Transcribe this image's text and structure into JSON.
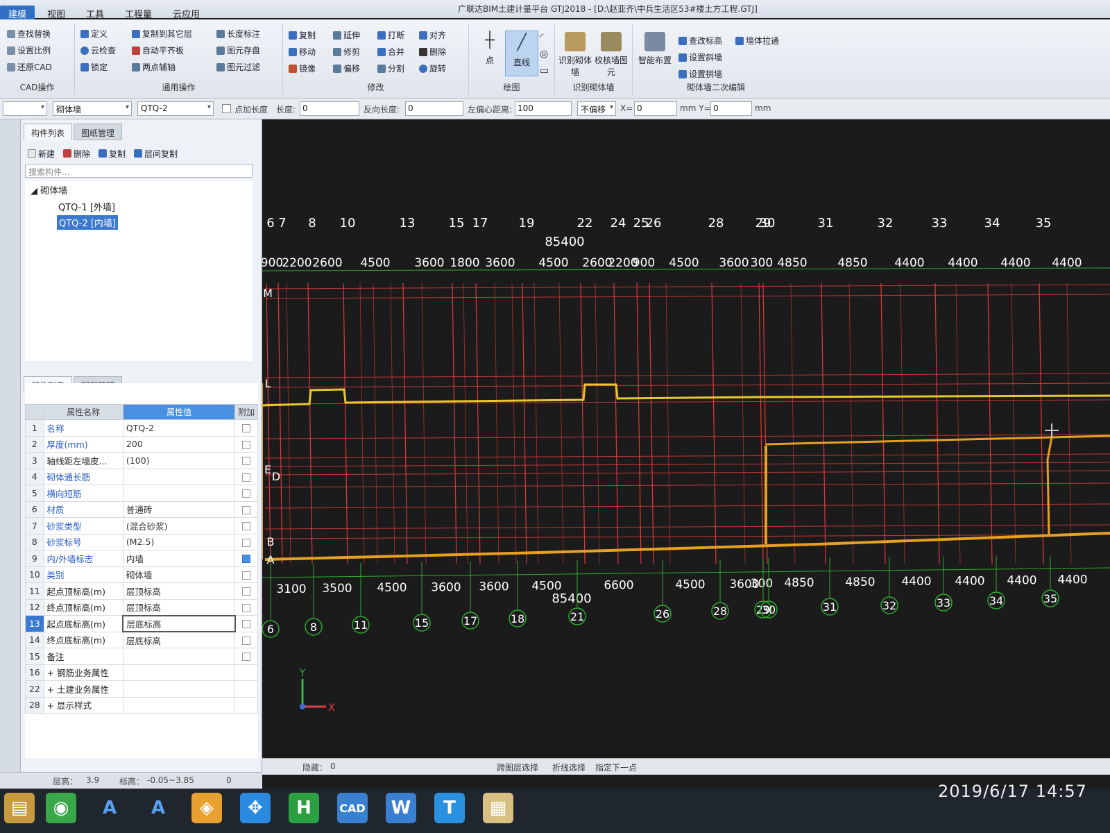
{
  "window": {
    "title": "广联达BIM土建计量平台 GTJ2018 - [D:\\赵亚齐\\中兵生活区53#楼土方工程.GTJ]"
  },
  "menu": [
    "建模",
    "视图",
    "工具",
    "工程量",
    "云应用"
  ],
  "ribbon": {
    "cad": {
      "items": [
        "查找替换",
        "设置比例",
        "还原CAD"
      ],
      "group": "CAD操作"
    },
    "common": {
      "items": [
        "定义",
        "复制到其它层",
        "长度标注",
        "云检查",
        "自动平齐板",
        "图元存盘",
        "锁定",
        "两点辅轴",
        "图元过滤"
      ],
      "group": "通用操作"
    },
    "modify": {
      "items": [
        "复制",
        "延伸",
        "打断",
        "对齐",
        "移动",
        "修剪",
        "合并",
        "删除",
        "镜像",
        "偏移",
        "分割",
        "旋转"
      ],
      "group": "修改"
    },
    "draw": {
      "items": [
        "点",
        "直线"
      ],
      "group": "绘图"
    },
    "identify": {
      "items": [
        "识别砌体墙",
        "校核墙图元"
      ],
      "group": "识别砌体墙"
    },
    "secondary": {
      "items": [
        "智能布置",
        "查改标高",
        "墙体拉通",
        "设置斜墙",
        "设置拱墙"
      ],
      "group": "砌体墙二次编辑"
    }
  },
  "toolbar": {
    "type_select": "砌体墙",
    "component_select": "QTQ-2",
    "add_length_label": "点加长度",
    "length_label": "长度:",
    "length_value": "0",
    "reverse_length_label": "反向长度:",
    "reverse_length_value": "0",
    "offset_label": "左偏心距离:",
    "offset_value": "100",
    "offset_mode": "不偏移",
    "x_label": "X=",
    "x_value": "0",
    "y_label": "mm  Y=",
    "y_value": "0",
    "unit": "mm"
  },
  "component_panel": {
    "tabs": [
      "构件列表",
      "图纸管理"
    ],
    "tools": [
      "新建",
      "删除",
      "复制",
      "层间复制"
    ],
    "search_placeholder": "搜索构件...",
    "tree_root": "砌体墙",
    "items": [
      "QTQ-1 [外墙]",
      "QTQ-2 [内墙]"
    ],
    "selected_index": 1
  },
  "property_panel": {
    "tabs": [
      "属性列表",
      "图层管理"
    ],
    "headers": [
      "属性名称",
      "属性值",
      "附加"
    ],
    "rows": [
      {
        "n": "1",
        "name": "名称",
        "value": "QTQ-2",
        "blue": true,
        "check": false
      },
      {
        "n": "2",
        "name": "厚度(mm)",
        "value": "200",
        "blue": true,
        "check": false
      },
      {
        "n": "3",
        "name": "轴线距左墙皮...",
        "value": "(100)",
        "blue": false,
        "check": false
      },
      {
        "n": "4",
        "name": "砌体通长筋",
        "value": "",
        "blue": true,
        "check": false
      },
      {
        "n": "5",
        "name": "横向短筋",
        "value": "",
        "blue": true,
        "check": false
      },
      {
        "n": "6",
        "name": "材质",
        "value": "普通砖",
        "blue": true,
        "check": false
      },
      {
        "n": "7",
        "name": "砂浆类型",
        "value": "(混合砂浆)",
        "blue": true,
        "check": false
      },
      {
        "n": "8",
        "name": "砂浆标号",
        "value": "(M2.5)",
        "blue": true,
        "check": false
      },
      {
        "n": "9",
        "name": "内/外墙标志",
        "value": "内墙",
        "blue": true,
        "check": true
      },
      {
        "n": "10",
        "name": "类别",
        "value": "砌体墙",
        "blue": true,
        "check": false
      },
      {
        "n": "11",
        "name": "起点顶标高(m)",
        "value": "层顶标高",
        "blue": false,
        "check": false
      },
      {
        "n": "12",
        "name": "终点顶标高(m)",
        "value": "层顶标高",
        "blue": false,
        "check": false
      },
      {
        "n": "13",
        "name": "起点底标高(m)",
        "value": "层底标高",
        "blue": false,
        "check": false
      },
      {
        "n": "14",
        "name": "终点底标高(m)",
        "value": "层底标高",
        "blue": false,
        "check": false
      },
      {
        "n": "15",
        "name": "备注",
        "value": "",
        "blue": false,
        "check": false
      },
      {
        "n": "16",
        "name": "+ 钢筋业务属性",
        "value": "",
        "blue": false,
        "check": null
      },
      {
        "n": "22",
        "name": "+ 土建业务属性",
        "value": "",
        "blue": false,
        "check": null
      },
      {
        "n": "28",
        "name": "+ 显示样式",
        "value": "",
        "blue": false,
        "check": null
      }
    ]
  },
  "drawing": {
    "top_axes": [
      "6",
      "7",
      "8",
      "10",
      "13",
      "15",
      "17",
      "19",
      "22",
      "24",
      "25",
      "26",
      "28",
      "29",
      "30",
      "31",
      "32",
      "33",
      "34",
      "35"
    ],
    "top_total": "85400",
    "top_dims": [
      "900",
      "2200",
      "2600",
      "4500",
      "3600",
      "1800",
      "3600",
      "4500",
      "2600",
      "2200",
      "900",
      "4500",
      "3600",
      "300",
      "4850",
      "4850",
      "4400",
      "4400",
      "4400",
      "4400"
    ],
    "row_labels": [
      "M",
      "L",
      "E",
      "D",
      "B",
      "A"
    ],
    "bottom_dims": [
      "3100",
      "3500",
      "4500",
      "3600",
      "3600",
      "4500",
      "6600",
      "4500",
      "3600",
      "300",
      "4850",
      "4850",
      "4400",
      "4400",
      "4400",
      "4400"
    ],
    "bottom_total": "85400",
    "bottom_axes": [
      "6",
      "8",
      "11",
      "15",
      "17",
      "18",
      "21",
      "26",
      "28",
      "29",
      "30",
      "31",
      "32",
      "33",
      "34",
      "35"
    ],
    "axis_x": "X",
    "axis_y": "Y"
  },
  "statusbar": {
    "floor_height_label": "层高：",
    "floor_height": "3.9",
    "elevation_label": "标高：",
    "elevation": "-0.05~3.85",
    "extra": "0",
    "hidden_label": "隐藏：",
    "hidden": "0",
    "hints": [
      "跨图层选择",
      "折线选择",
      "指定下一点"
    ]
  },
  "clock": "2019/6/17  14:57",
  "colors": {
    "grid": "#e03a3a",
    "wall": "#e8a020",
    "dim": "#2faa2f",
    "selected": "#3b78d0"
  }
}
